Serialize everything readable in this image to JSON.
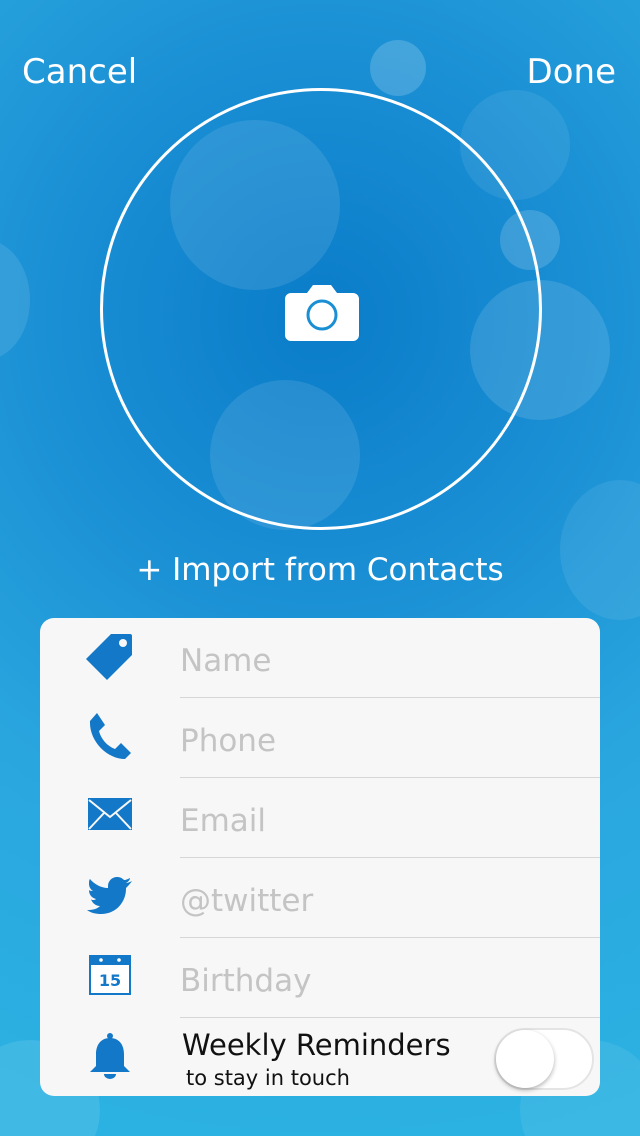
{
  "nav": {
    "cancel_label": "Cancel",
    "done_label": "Done"
  },
  "photo": {
    "icon": "camera-icon"
  },
  "import_label": "+ Import from Contacts",
  "fields": {
    "name": {
      "icon": "tag-icon",
      "placeholder": "Name",
      "value": ""
    },
    "phone": {
      "icon": "phone-icon",
      "placeholder": "Phone",
      "value": ""
    },
    "email": {
      "icon": "envelope-icon",
      "placeholder": "Email",
      "value": ""
    },
    "twitter": {
      "icon": "twitter-bird-icon",
      "placeholder": "@twitter",
      "value": ""
    },
    "birthday": {
      "icon": "calendar-icon",
      "placeholder": "Birthday",
      "value": "",
      "calendar_day": "15"
    }
  },
  "reminders": {
    "icon": "bell-icon",
    "title": "Weekly Reminders",
    "subtitle": "to stay in touch",
    "enabled": false
  },
  "colors": {
    "accent": "#1478c8",
    "background": "#1a8fd4",
    "card": "#f7f7f7"
  }
}
